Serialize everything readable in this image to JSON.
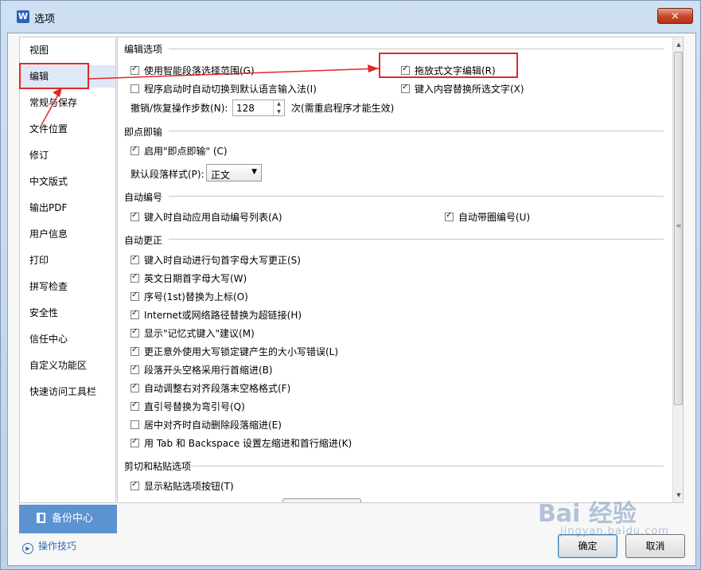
{
  "window": {
    "title": "选项",
    "close_label": "×"
  },
  "sidebar": {
    "items": [
      {
        "label": "视图"
      },
      {
        "label": "编辑"
      },
      {
        "label": "常规与保存"
      },
      {
        "label": "文件位置"
      },
      {
        "label": "修订"
      },
      {
        "label": "中文版式"
      },
      {
        "label": "输出PDF"
      },
      {
        "label": "用户信息"
      },
      {
        "label": "打印"
      },
      {
        "label": "拼写检查"
      },
      {
        "label": "安全性"
      },
      {
        "label": "信任中心"
      },
      {
        "label": "自定义功能区"
      },
      {
        "label": "快速访问工具栏"
      }
    ],
    "selected": "编辑",
    "backup_label": "备份中心",
    "tips_label": "操作技巧"
  },
  "edit_options": {
    "title": "编辑选项",
    "smart_paragraph": {
      "label": "使用智能段落选择范围(G)",
      "checked": true
    },
    "drag_drop": {
      "label": "拖放式文字编辑(R)",
      "checked": true
    },
    "auto_ime": {
      "label": "程序启动时自动切换到默认语言输入法(I)",
      "checked": false
    },
    "replace_selection": {
      "label": "键入内容替换所选文字(X)",
      "checked": true
    },
    "undo_label": "撤销/恢复操作步数(N):",
    "undo_value": "128",
    "undo_note": "次(需重启程序才能生效)"
  },
  "click_and_type": {
    "title": "即点即输",
    "enable": {
      "label": "启用\"即点即输\" (C)",
      "checked": true
    },
    "style_label": "默认段落样式(P):",
    "style_value": "正文"
  },
  "auto_number": {
    "title": "自动编号",
    "auto_list": {
      "label": "键入时自动应用自动编号列表(A)",
      "checked": true
    },
    "circled": {
      "label": "自动带圈编号(U)",
      "checked": true
    }
  },
  "auto_correct": {
    "title": "自动更正",
    "items": [
      {
        "label": "键入时自动进行句首字母大写更正(S)",
        "checked": true
      },
      {
        "label": "英文日期首字母大写(W)",
        "checked": true
      },
      {
        "label": "序号(1st)替换为上标(O)",
        "checked": true
      },
      {
        "label": "Internet或网络路径替换为超链接(H)",
        "checked": true
      },
      {
        "label": "显示\"记忆式键入\"建议(M)",
        "checked": true
      },
      {
        "label": "更正意外使用大写锁定键产生的大小写错误(L)",
        "checked": true
      },
      {
        "label": "段落开头空格采用行首缩进(B)",
        "checked": true
      },
      {
        "label": "自动调整右对齐段落末空格格式(F)",
        "checked": true
      },
      {
        "label": "直引号替换为弯引号(Q)",
        "checked": true
      },
      {
        "label": "居中对齐时自动删除段落缩进(E)",
        "checked": false
      },
      {
        "label": "用 Tab 和 Backspace 设置左缩进和首行缩进(K)",
        "checked": true
      }
    ]
  },
  "cut_paste": {
    "title": "剪切和粘贴选项",
    "show_button": {
      "label": "显示粘贴选项按钮(T)",
      "checked": true
    }
  },
  "buttons": {
    "ok": "确定",
    "cancel": "取消"
  },
  "watermark": {
    "text": "Bai 经验",
    "sub": "jingyan.baidu.com"
  },
  "colors": {
    "annotation": "#e02828",
    "backup_bg": "#5b93d1",
    "selected_bg": "#dfe8f6"
  }
}
